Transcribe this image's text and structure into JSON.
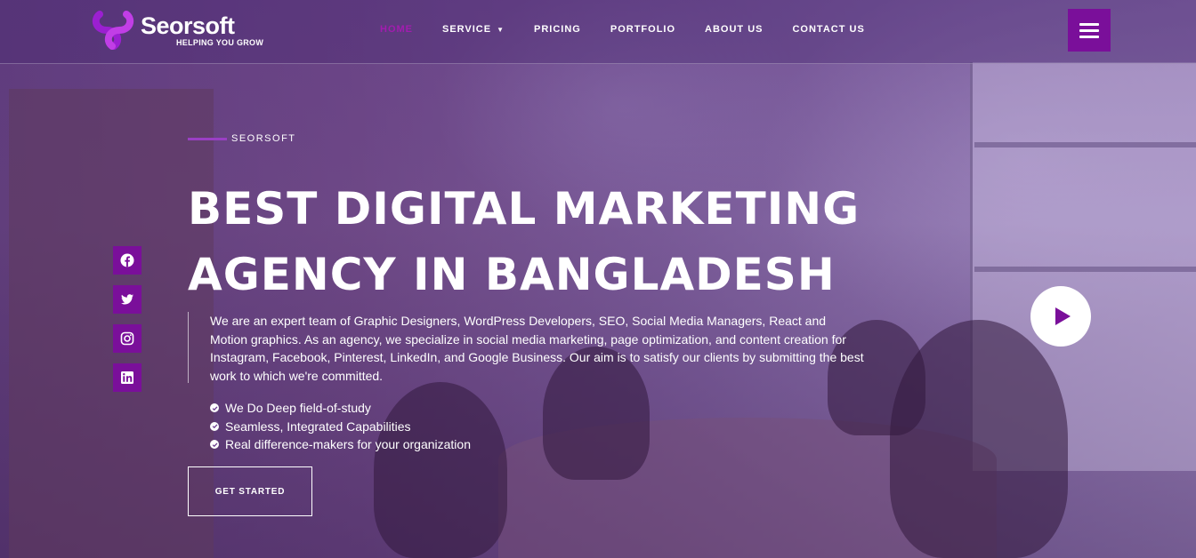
{
  "brand": {
    "name": "Seorsoft",
    "tagline": "HELPING YOU GROW",
    "accent": "#7a0f9a",
    "active_nav_color": "#a21caf"
  },
  "nav": {
    "items": [
      {
        "label": "HOME",
        "active": true
      },
      {
        "label": "SERVICE",
        "has_dropdown": true
      },
      {
        "label": "PRICING"
      },
      {
        "label": "PORTFOLIO"
      },
      {
        "label": "ABOUT US"
      },
      {
        "label": "CONTACT US"
      }
    ],
    "menu_icon": "hamburger-icon"
  },
  "social": [
    "facebook-icon",
    "twitter-icon",
    "instagram-icon",
    "linkedin-icon"
  ],
  "hero": {
    "eyebrow": "SEORSOFT",
    "title_line1": "BEST DIGITAL MARKETING",
    "title_line2": "AGENCY IN BANGLADESH",
    "description": "We are an expert team of Graphic Designers, WordPress Developers, SEO, Social Media Managers, React and Motion graphics. As an agency, we specialize in social media marketing, page optimization, and content creation for Instagram, Facebook, Pinterest, LinkedIn, and Google Business. Our aim is to satisfy our clients by submitting the best work to which we're committed.",
    "checklist": [
      "We Do Deep field-of-study",
      "Seamless, Integrated Capabilities",
      "Real difference-makers for your organization"
    ],
    "cta_label": "GET STARTED",
    "play_icon": "play-icon"
  }
}
